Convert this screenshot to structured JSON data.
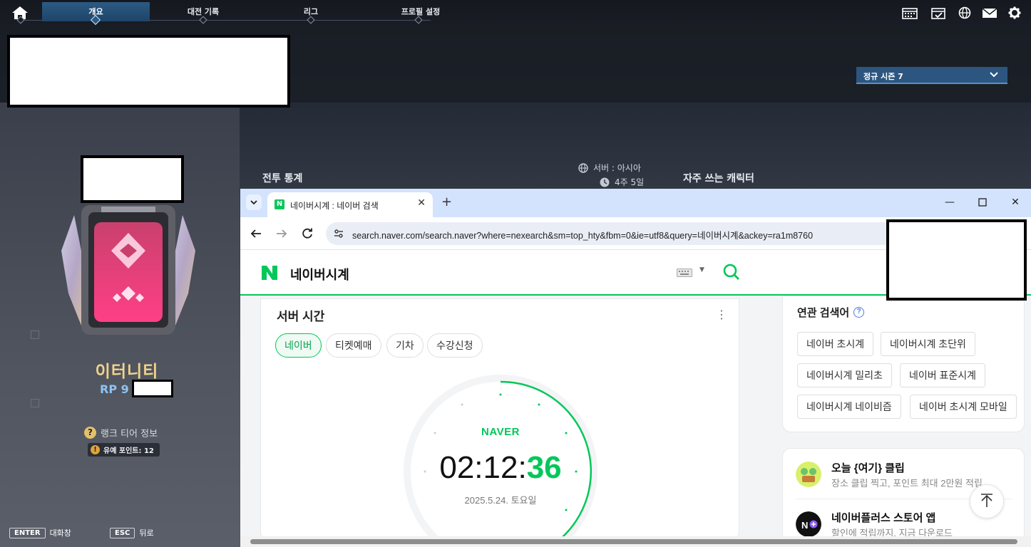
{
  "game": {
    "nav": {
      "tabs": [
        {
          "label": "개요",
          "active": true
        },
        {
          "label": "대전 기록",
          "active": false
        },
        {
          "label": "리그",
          "active": false
        },
        {
          "label": "프로필 설정",
          "active": false
        }
      ],
      "right_icons": [
        "calendar-icon",
        "calendar-check-icon",
        "globe-icon",
        "mail-icon",
        "gear-icon"
      ]
    },
    "season_select": "정규 시즌 7",
    "stats_heading": "전투 통계",
    "server": {
      "label": "서버 : 아시아",
      "weeks": "4주 5일"
    },
    "frequent_heading": "자주 쓰는 캐릭터",
    "tier_name": "이터니티",
    "rp_prefix": "RP 9",
    "rank_info": "랭크 티어 정보",
    "grace_points": "유예 포인트: 12",
    "hints": [
      {
        "key": "ENTER",
        "label": "대화창"
      },
      {
        "key": "ESC",
        "label": "뒤로"
      }
    ],
    "colors": {
      "accent": "#2c5a84",
      "tier_gold": "#f2d38a",
      "rp_blue": "#8fc3f2"
    }
  },
  "browser": {
    "tab_title": "네이버시계 : 네이버 검색",
    "url": "search.naver.com/search.naver?where=nexearch&sm=top_hty&fbm=0&ie=utf8&query=네이버시계&ackey=ra1m8760",
    "search_query": "네이버시계",
    "time_card": {
      "title": "서버 시간",
      "chips": [
        {
          "label": "네이버",
          "active": true
        },
        {
          "label": "티켓예매",
          "active": false
        },
        {
          "label": "기차",
          "active": false
        },
        {
          "label": "수강신청",
          "active": false
        }
      ],
      "brand": "NAVER",
      "time_hm": "02:12:",
      "time_s": "36",
      "date": "2025.5.24. 토요일"
    },
    "related": {
      "title": "연관 검색어",
      "keywords": [
        "네이버 초시계",
        "네이버시계 초단위",
        "네이버시계 밀리초",
        "네이버 표준시계",
        "네이버시계 네이비즘",
        "네이버 초시계 모바일"
      ]
    },
    "clips": [
      {
        "title": "오늘 {여기} 클립",
        "sub": "장소 클립 찍고, 포인트 최대 2만원 적립"
      },
      {
        "title": "네이버플러스 스토어 앱",
        "sub": "할인에 적립까지, 지금 다운로드"
      }
    ],
    "colors": {
      "naver_green": "#03c75a",
      "tabstrip": "#d3e3fd"
    }
  }
}
